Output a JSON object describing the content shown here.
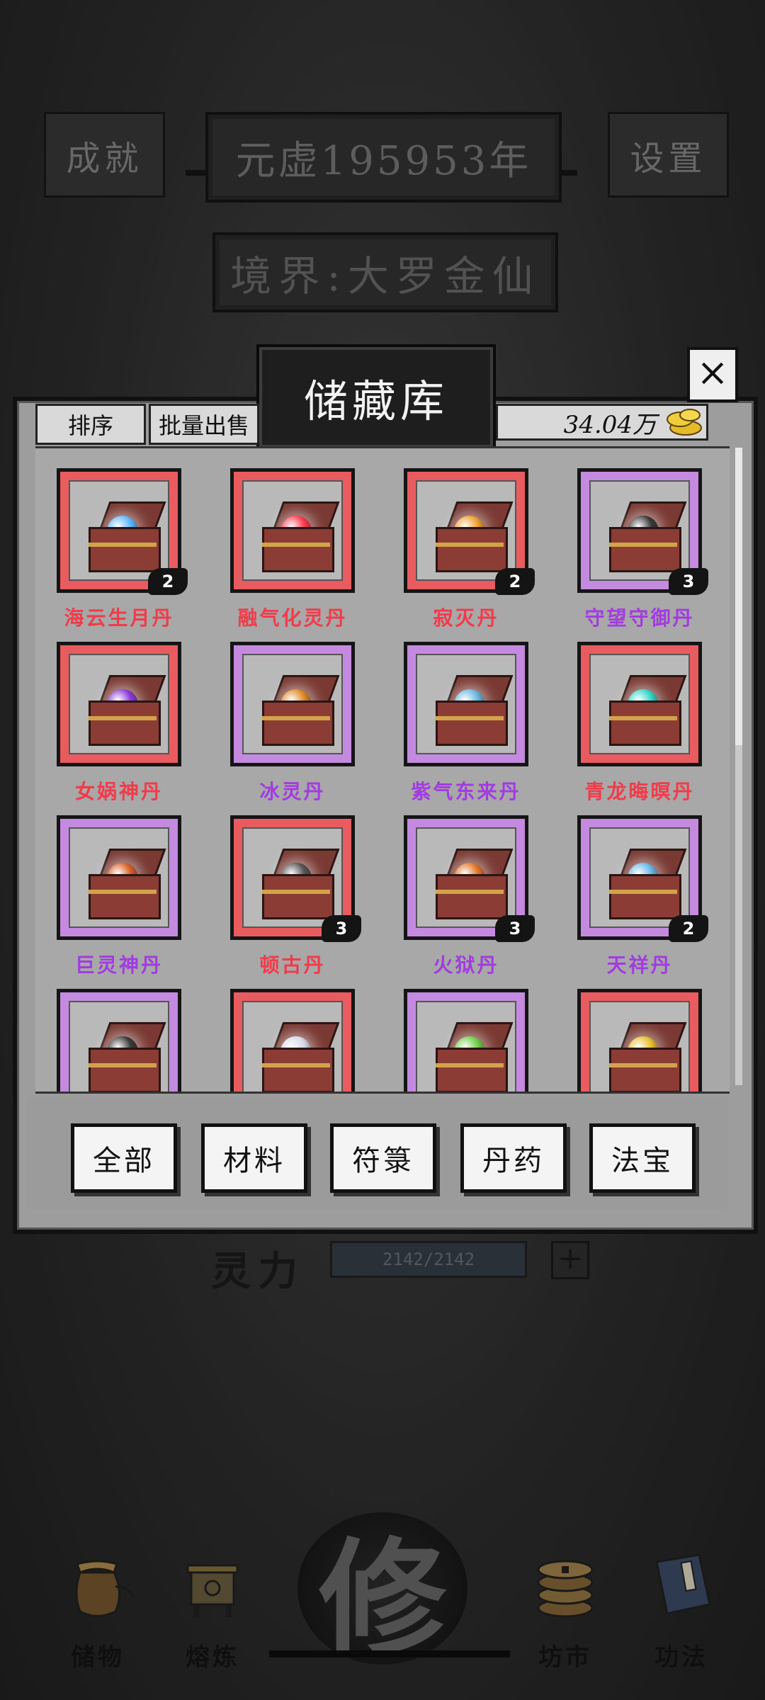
{
  "top_bar": {
    "achievements_label": "成就",
    "year_text": "元虚195953年",
    "settings_label": "设置",
    "realm_text": "境界:大罗金仙"
  },
  "modal": {
    "title": "储藏库",
    "close_label": "×",
    "sort_label": "排序",
    "bulk_sell_label": "批量出售",
    "currency_value": "34.04万",
    "currency_icon": "gold-coins-icon"
  },
  "colors": {
    "rarity_red": "#e85b5f",
    "rarity_purple": "#c48ae0"
  },
  "items": [
    {
      "name": "海云生月丹",
      "rarity": "red",
      "count": "2",
      "orb": "#5fb7ff"
    },
    {
      "name": "融气化灵丹",
      "rarity": "red",
      "count": "",
      "orb": "#ff3b4f"
    },
    {
      "name": "寂灭丹",
      "rarity": "red",
      "count": "2",
      "orb": "#f0a030"
    },
    {
      "name": "守望守御丹",
      "rarity": "purple",
      "count": "3",
      "orb": "#3a3a3a"
    },
    {
      "name": "女娲神丹",
      "rarity": "red",
      "count": "",
      "orb": "#8a3ad8"
    },
    {
      "name": "冰灵丹",
      "rarity": "purple",
      "count": "",
      "orb": "#e08a28"
    },
    {
      "name": "紫气东来丹",
      "rarity": "purple",
      "count": "",
      "orb": "#6ab8e0"
    },
    {
      "name": "青龙晦暝丹",
      "rarity": "red",
      "count": "",
      "orb": "#33d6c8"
    },
    {
      "name": "巨灵神丹",
      "rarity": "purple",
      "count": "",
      "orb": "#d6602a"
    },
    {
      "name": "顿古丹",
      "rarity": "red",
      "count": "3",
      "orb": "#555555"
    },
    {
      "name": "火狱丹",
      "rarity": "purple",
      "count": "3",
      "orb": "#e0782a"
    },
    {
      "name": "天祥丹",
      "rarity": "purple",
      "count": "2",
      "orb": "#6cb8e8"
    },
    {
      "name": "",
      "rarity": "purple",
      "count": "",
      "orb": "#3a3a3a"
    },
    {
      "name": "",
      "rarity": "red",
      "count": "",
      "orb": "#d8d8e8"
    },
    {
      "name": "",
      "rarity": "purple",
      "count": "",
      "orb": "#6fd04a"
    },
    {
      "name": "",
      "rarity": "red",
      "count": "",
      "orb": "#e8c030"
    }
  ],
  "categories": [
    "全部",
    "材料",
    "符箓",
    "丹药",
    "法宝"
  ],
  "lingli": {
    "label": "灵力",
    "value": "2142/2142",
    "plus_label": "+"
  },
  "bottom_nav": {
    "storage_label": "储物",
    "smelt_label": "熔炼",
    "cultivate_label": "修",
    "market_label": "坊市",
    "skills_label": "功法"
  }
}
